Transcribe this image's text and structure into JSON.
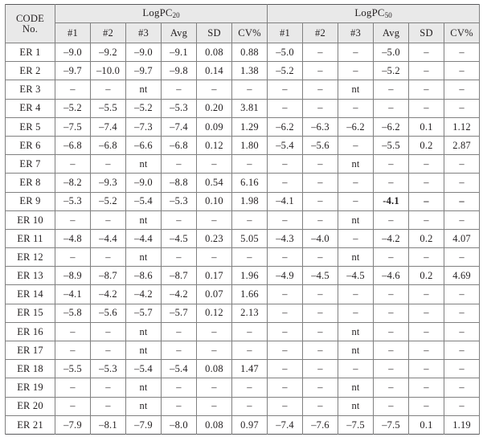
{
  "table": {
    "code_header": "CODE No.",
    "code_header_line1": "CODE",
    "code_header_line2": "No.",
    "groups": [
      {
        "label_prefix": "LogPC",
        "label_sub": "20",
        "full": "LogPC20"
      },
      {
        "label_prefix": "LogPC",
        "label_sub": "50",
        "full": "LogPC50"
      }
    ],
    "sub_headers": [
      "#1",
      "#2",
      "#3",
      "Avg",
      "SD",
      "CV%"
    ],
    "dash": "–",
    "nt": "nt",
    "rows": [
      {
        "code": "ER 1",
        "pc20": [
          "–9.0",
          "–9.2",
          "–9.0",
          "–9.1",
          "0.08",
          "0.88"
        ],
        "pc50": [
          "–5.0",
          "–",
          "–",
          "–5.0",
          "–",
          "–"
        ]
      },
      {
        "code": "ER 2",
        "pc20": [
          "–9.7",
          "–10.0",
          "–9.7",
          "–9.8",
          "0.14",
          "1.38"
        ],
        "pc50": [
          "–5.2",
          "–",
          "–",
          "–5.2",
          "–",
          "–"
        ]
      },
      {
        "code": "ER 3",
        "pc20": [
          "–",
          "–",
          "nt",
          "–",
          "–",
          "–"
        ],
        "pc50": [
          "–",
          "–",
          "nt",
          "–",
          "–",
          "–"
        ]
      },
      {
        "code": "ER 4",
        "pc20": [
          "–5.2",
          "–5.5",
          "–5.2",
          "–5.3",
          "0.20",
          "3.81"
        ],
        "pc50": [
          "–",
          "–",
          "–",
          "–",
          "–",
          "–"
        ]
      },
      {
        "code": "ER 5",
        "pc20": [
          "–7.5",
          "–7.4",
          "–7.3",
          "–7.4",
          "0.09",
          "1.29"
        ],
        "pc50": [
          "–6.2",
          "–6.3",
          "–6.2",
          "–6.2",
          "0.1",
          "1.12"
        ]
      },
      {
        "code": "ER 6",
        "pc20": [
          "–6.8",
          "–6.8",
          "–6.6",
          "–6.8",
          "0.12",
          "1.80"
        ],
        "pc50": [
          "–5.4",
          "–5.6",
          "–",
          "–5.5",
          "0.2",
          "2.87"
        ]
      },
      {
        "code": "ER 7",
        "pc20": [
          "–",
          "–",
          "nt",
          "–",
          "–",
          "–"
        ],
        "pc50": [
          "–",
          "–",
          "nt",
          "–",
          "–",
          "–"
        ]
      },
      {
        "code": "ER 8",
        "pc20": [
          "–8.2",
          "–9.3",
          "–9.0",
          "–8.8",
          "0.54",
          "6.16"
        ],
        "pc50": [
          "–",
          "–",
          "–",
          "–",
          "–",
          "–"
        ]
      },
      {
        "code": "ER 9",
        "pc20": [
          "–5.3",
          "–5.2",
          "–5.4",
          "–5.3",
          "0.10",
          "1.98"
        ],
        "pc50": [
          "–4.1",
          "–",
          "–",
          "-4.1",
          "–",
          "–"
        ],
        "pc50_bold": [
          false,
          false,
          false,
          true,
          true,
          true
        ]
      },
      {
        "code": "ER 10",
        "pc20": [
          "–",
          "–",
          "nt",
          "–",
          "–",
          "–"
        ],
        "pc50": [
          "–",
          "–",
          "nt",
          "–",
          "–",
          "–"
        ]
      },
      {
        "code": "ER 11",
        "pc20": [
          "–4.8",
          "–4.4",
          "–4.4",
          "–4.5",
          "0.23",
          "5.05"
        ],
        "pc50": [
          "–4.3",
          "–4.0",
          "–",
          "–4.2",
          "0.2",
          "4.07"
        ]
      },
      {
        "code": "ER 12",
        "pc20": [
          "–",
          "–",
          "nt",
          "–",
          "–",
          "–"
        ],
        "pc50": [
          "–",
          "–",
          "nt",
          "–",
          "–",
          "–"
        ]
      },
      {
        "code": "ER 13",
        "pc20": [
          "–8.9",
          "–8.7",
          "–8.6",
          "–8.7",
          "0.17",
          "1.96"
        ],
        "pc50": [
          "–4.9",
          "–4.5",
          "–4.5",
          "–4.6",
          "0.2",
          "4.69"
        ]
      },
      {
        "code": "ER 14",
        "pc20": [
          "–4.1",
          "–4.2",
          "–4.2",
          "–4.2",
          "0.07",
          "1.66"
        ],
        "pc50": [
          "–",
          "–",
          "–",
          "–",
          "–",
          "–"
        ]
      },
      {
        "code": "ER 15",
        "pc20": [
          "–5.8",
          "–5.6",
          "–5.7",
          "–5.7",
          "0.12",
          "2.13"
        ],
        "pc50": [
          "–",
          "–",
          "–",
          "–",
          "–",
          "–"
        ]
      },
      {
        "code": "ER 16",
        "pc20": [
          "–",
          "–",
          "nt",
          "–",
          "–",
          "–"
        ],
        "pc50": [
          "–",
          "–",
          "nt",
          "–",
          "–",
          "–"
        ]
      },
      {
        "code": "ER 17",
        "pc20": [
          "–",
          "–",
          "nt",
          "–",
          "–",
          "–"
        ],
        "pc50": [
          "–",
          "–",
          "nt",
          "–",
          "–",
          "–"
        ]
      },
      {
        "code": "ER 18",
        "pc20": [
          "–5.5",
          "–5.3",
          "–5.4",
          "–5.4",
          "0.08",
          "1.47"
        ],
        "pc50": [
          "–",
          "–",
          "–",
          "–",
          "–",
          "–"
        ]
      },
      {
        "code": "ER 19",
        "pc20": [
          "–",
          "–",
          "nt",
          "–",
          "–",
          "–"
        ],
        "pc50": [
          "–",
          "–",
          "nt",
          "–",
          "–",
          "–"
        ]
      },
      {
        "code": "ER 20",
        "pc20": [
          "–",
          "–",
          "nt",
          "–",
          "–",
          "–"
        ],
        "pc50": [
          "–",
          "–",
          "nt",
          "–",
          "–",
          "–"
        ]
      },
      {
        "code": "ER 21",
        "pc20": [
          "–7.9",
          "–8.1",
          "–7.9",
          "–8.0",
          "0.08",
          "0.97"
        ],
        "pc50": [
          "–7.4",
          "–7.6",
          "–7.5",
          "–7.5",
          "0.1",
          "1.19"
        ]
      }
    ]
  },
  "colors": {
    "header_fill": "#e9e9e9",
    "grid_line": "#808080",
    "outer_rule": "#58595b",
    "text": "#231f20",
    "cell_fill": "#ffffff"
  }
}
